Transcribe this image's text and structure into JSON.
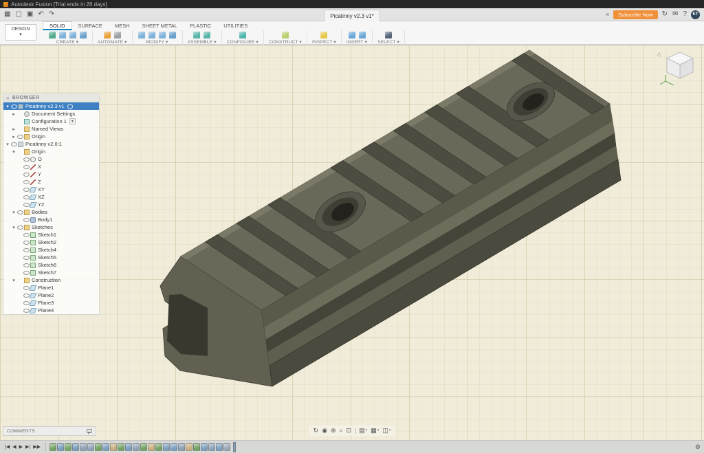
{
  "glyphs": {
    "caret": "▾",
    "home": "⌂",
    "collapse": "«",
    "gear": "⚙"
  },
  "colors": {
    "accent_blue": "#0a84c1",
    "subscribe_orange": "#f0913a",
    "selection_blue": "#3e80c4",
    "canvas_bg": "#f1ecda",
    "model_olive": "#6a6959"
  },
  "titlebar": {
    "title": "Autodesk Fusion [Trial ends in 26 days]"
  },
  "appbar": {
    "doc_tab": "Picatinny v2.3 v1*",
    "close_glyph": "×",
    "subscribe_label": "Subscribe Now",
    "avatar": "KT",
    "left_icons": [
      {
        "name": "app-grid-icon",
        "glyph": "▦"
      },
      {
        "name": "file-new-icon",
        "glyph": "▢"
      },
      {
        "name": "save-icon",
        "glyph": "▣"
      },
      {
        "name": "undo-icon",
        "glyph": "↶"
      },
      {
        "name": "redo-icon",
        "glyph": "↷"
      }
    ],
    "right_icons": [
      {
        "name": "job-status-icon",
        "glyph": "↻"
      },
      {
        "name": "notifications-icon",
        "glyph": "✉"
      },
      {
        "name": "help-icon",
        "glyph": "?"
      }
    ]
  },
  "ribbon": {
    "design_label": "DESIGN",
    "tabs": [
      "SOLID",
      "SURFACE",
      "MESH",
      "SHEET METAL",
      "PLASTIC",
      "UTILITIES"
    ],
    "active_tab": "SOLID",
    "groups": [
      {
        "label": "CREATE",
        "icons": [
          {
            "name": "new-sketch-icon",
            "color": "#56ab8f"
          },
          {
            "name": "box-primitive-icon",
            "color": "#7fb2d9"
          },
          {
            "name": "cylinder-primitive-icon",
            "color": "#7fb2d9"
          },
          {
            "name": "extrude-icon",
            "color": "#6aa0cc"
          }
        ]
      },
      {
        "label": "AUTOMATE",
        "icons": [
          {
            "name": "automation-icon",
            "color": "#e8a33d"
          },
          {
            "name": "scripts-addins-icon",
            "color": "#9aa0a6"
          }
        ]
      },
      {
        "label": "MODIFY",
        "icons": [
          {
            "name": "press-pull-icon",
            "color": "#7fb2d9"
          },
          {
            "name": "fillet-icon",
            "color": "#7fb2d9"
          },
          {
            "name": "shell-icon",
            "color": "#7fb2d9"
          },
          {
            "name": "combine-icon",
            "color": "#6aa0cc"
          }
        ]
      },
      {
        "label": "ASSEMBLE",
        "icons": [
          {
            "name": "new-component-icon",
            "color": "#59b5a8"
          },
          {
            "name": "joint-icon",
            "color": "#59b5a8"
          }
        ]
      },
      {
        "label": "CONFIGURE",
        "icons": [
          {
            "name": "configurations-icon",
            "color": "#4db6ac"
          }
        ]
      },
      {
        "label": "CONSTRUCT",
        "icons": [
          {
            "name": "construction-plane-icon",
            "color": "#b9cf6e"
          }
        ]
      },
      {
        "label": "INSPECT",
        "icons": [
          {
            "name": "measure-icon",
            "color": "#e8c84a"
          }
        ]
      },
      {
        "label": "INSERT",
        "icons": [
          {
            "name": "insert-mcmaster-icon",
            "color": "#6aa7d8"
          },
          {
            "name": "insert-decal-icon",
            "color": "#6aa7d8"
          }
        ]
      },
      {
        "label": "SELECT",
        "icons": [
          {
            "name": "select-cursor-icon",
            "color": "#55657a"
          }
        ]
      }
    ]
  },
  "browser": {
    "header": "BROWSER",
    "items": [
      {
        "lvl": 0,
        "arrow": "open",
        "eye": true,
        "icon": "doc",
        "label": "Picatinny v2.3 v1",
        "sel": true,
        "badge": true
      },
      {
        "lvl": 1,
        "arrow": "closed",
        "eye": false,
        "icon": "settings",
        "label": "Document Settings"
      },
      {
        "lvl": 1,
        "arrow": null,
        "eye": false,
        "icon": "config",
        "label": "Configuration 1",
        "dropdown": true
      },
      {
        "lvl": 1,
        "arrow": "closed",
        "eye": false,
        "icon": "folder",
        "label": "Named Views"
      },
      {
        "lvl": 1,
        "arrow": "closed",
        "eye": true,
        "icon": "folder",
        "label": "Origin"
      },
      {
        "lvl": 0,
        "arrow": "open",
        "eye": true,
        "icon": "component",
        "label": "Picatinny v2.0:1"
      },
      {
        "lvl": 1,
        "arrow": "open",
        "eye": false,
        "icon": "folder",
        "label": "Origin"
      },
      {
        "lvl": 2,
        "arrow": null,
        "eye": true,
        "icon": "origin",
        "label": "O"
      },
      {
        "lvl": 2,
        "arrow": null,
        "eye": true,
        "icon": "axis",
        "label": "X"
      },
      {
        "lvl": 2,
        "arrow": null,
        "eye": true,
        "icon": "axis",
        "label": "Y"
      },
      {
        "lvl": 2,
        "arrow": null,
        "eye": true,
        "icon": "axis",
        "label": "Z"
      },
      {
        "lvl": 2,
        "arrow": null,
        "eye": true,
        "icon": "plane",
        "label": "XY"
      },
      {
        "lvl": 2,
        "arrow": null,
        "eye": true,
        "icon": "plane",
        "label": "XZ"
      },
      {
        "lvl": 2,
        "arrow": null,
        "eye": true,
        "icon": "plane",
        "label": "YZ"
      },
      {
        "lvl": 1,
        "arrow": "open",
        "eye": true,
        "icon": "folder",
        "label": "Bodies"
      },
      {
        "lvl": 2,
        "arrow": null,
        "eye": true,
        "icon": "body",
        "label": "Body1"
      },
      {
        "lvl": 1,
        "arrow": "open",
        "eye": true,
        "icon": "folder",
        "label": "Sketches"
      },
      {
        "lvl": 2,
        "arrow": null,
        "eye": true,
        "icon": "sketch",
        "label": "Sketch1"
      },
      {
        "lvl": 2,
        "arrow": null,
        "eye": true,
        "icon": "sketch",
        "label": "Sketch2"
      },
      {
        "lvl": 2,
        "arrow": null,
        "eye": true,
        "icon": "sketch",
        "label": "Sketch4"
      },
      {
        "lvl": 2,
        "arrow": null,
        "eye": true,
        "icon": "sketch",
        "label": "Sketch5"
      },
      {
        "lvl": 2,
        "arrow": null,
        "eye": true,
        "icon": "sketch",
        "label": "Sketch6"
      },
      {
        "lvl": 2,
        "arrow": null,
        "eye": true,
        "icon": "sketch",
        "label": "Sketch7"
      },
      {
        "lvl": 1,
        "arrow": "open",
        "eye": false,
        "icon": "folder",
        "label": "Construction"
      },
      {
        "lvl": 2,
        "arrow": null,
        "eye": true,
        "icon": "plane",
        "label": "Plane1"
      },
      {
        "lvl": 2,
        "arrow": null,
        "eye": true,
        "icon": "plane",
        "label": "Plane2"
      },
      {
        "lvl": 2,
        "arrow": null,
        "eye": true,
        "icon": "plane",
        "label": "Plane3"
      },
      {
        "lvl": 2,
        "arrow": null,
        "eye": true,
        "icon": "plane",
        "label": "Plane4"
      }
    ]
  },
  "navbar": {
    "items": [
      {
        "type": "icon",
        "name": "orbit-icon",
        "glyph": "↻"
      },
      {
        "type": "icon",
        "name": "look-at-icon",
        "glyph": "◉"
      },
      {
        "type": "icon",
        "name": "pan-icon",
        "glyph": "⊕"
      },
      {
        "type": "icon",
        "name": "zoom-icon",
        "glyph": "⌕"
      },
      {
        "type": "icon",
        "name": "fit-icon",
        "glyph": "⊡"
      },
      {
        "type": "sep"
      },
      {
        "type": "icon",
        "name": "display-settings-icon",
        "glyph": "▤",
        "dd": true
      },
      {
        "type": "icon",
        "name": "grid-snaps-icon",
        "glyph": "▦",
        "dd": true
      },
      {
        "type": "icon",
        "name": "viewports-icon",
        "glyph": "◫",
        "dd": true
      }
    ]
  },
  "comments": {
    "label": "COMMENTS"
  },
  "timeline": {
    "controls": [
      {
        "name": "go-to-start-icon",
        "glyph": "|◀"
      },
      {
        "name": "step-back-icon",
        "glyph": "◀"
      },
      {
        "name": "play-icon",
        "glyph": "▶"
      },
      {
        "name": "step-forward-icon",
        "glyph": "▶|"
      },
      {
        "name": "go-to-end-icon",
        "glyph": "▶▶"
      }
    ],
    "features": [
      {
        "name": "timeline-sketch",
        "color": "#74a364"
      },
      {
        "name": "timeline-extrude",
        "color": "#7d9fc0"
      },
      {
        "name": "timeline-sketch",
        "color": "#74a364"
      },
      {
        "name": "timeline-extrude",
        "color": "#7d9fc0"
      },
      {
        "name": "timeline-fillet",
        "color": "#8fa3b8"
      },
      {
        "name": "timeline-fillet",
        "color": "#8fa3b8"
      },
      {
        "name": "timeline-sketch",
        "color": "#74a364"
      },
      {
        "name": "timeline-extrude",
        "color": "#7d9fc0"
      },
      {
        "name": "timeline-plane",
        "color": "#c9b080"
      },
      {
        "name": "timeline-sketch",
        "color": "#74a364"
      },
      {
        "name": "timeline-extrude",
        "color": "#7d9fc0"
      },
      {
        "name": "timeline-fillet",
        "color": "#8fa3b8"
      },
      {
        "name": "timeline-sketch",
        "color": "#74a364"
      },
      {
        "name": "timeline-plane",
        "color": "#c9b080"
      },
      {
        "name": "timeline-sketch",
        "color": "#74a364"
      },
      {
        "name": "timeline-extrude",
        "color": "#7d9fc0"
      },
      {
        "name": "timeline-hole",
        "color": "#7d9fc0"
      },
      {
        "name": "timeline-fillet",
        "color": "#8fa3b8"
      },
      {
        "name": "timeline-plane",
        "color": "#c9b080"
      },
      {
        "name": "timeline-sketch",
        "color": "#74a364"
      },
      {
        "name": "timeline-extrude",
        "color": "#7d9fc0"
      },
      {
        "name": "timeline-chamfer",
        "color": "#8fa3b8"
      },
      {
        "name": "timeline-hole",
        "color": "#7d9fc0"
      },
      {
        "name": "timeline-mirror",
        "color": "#9aa7b5"
      }
    ]
  }
}
